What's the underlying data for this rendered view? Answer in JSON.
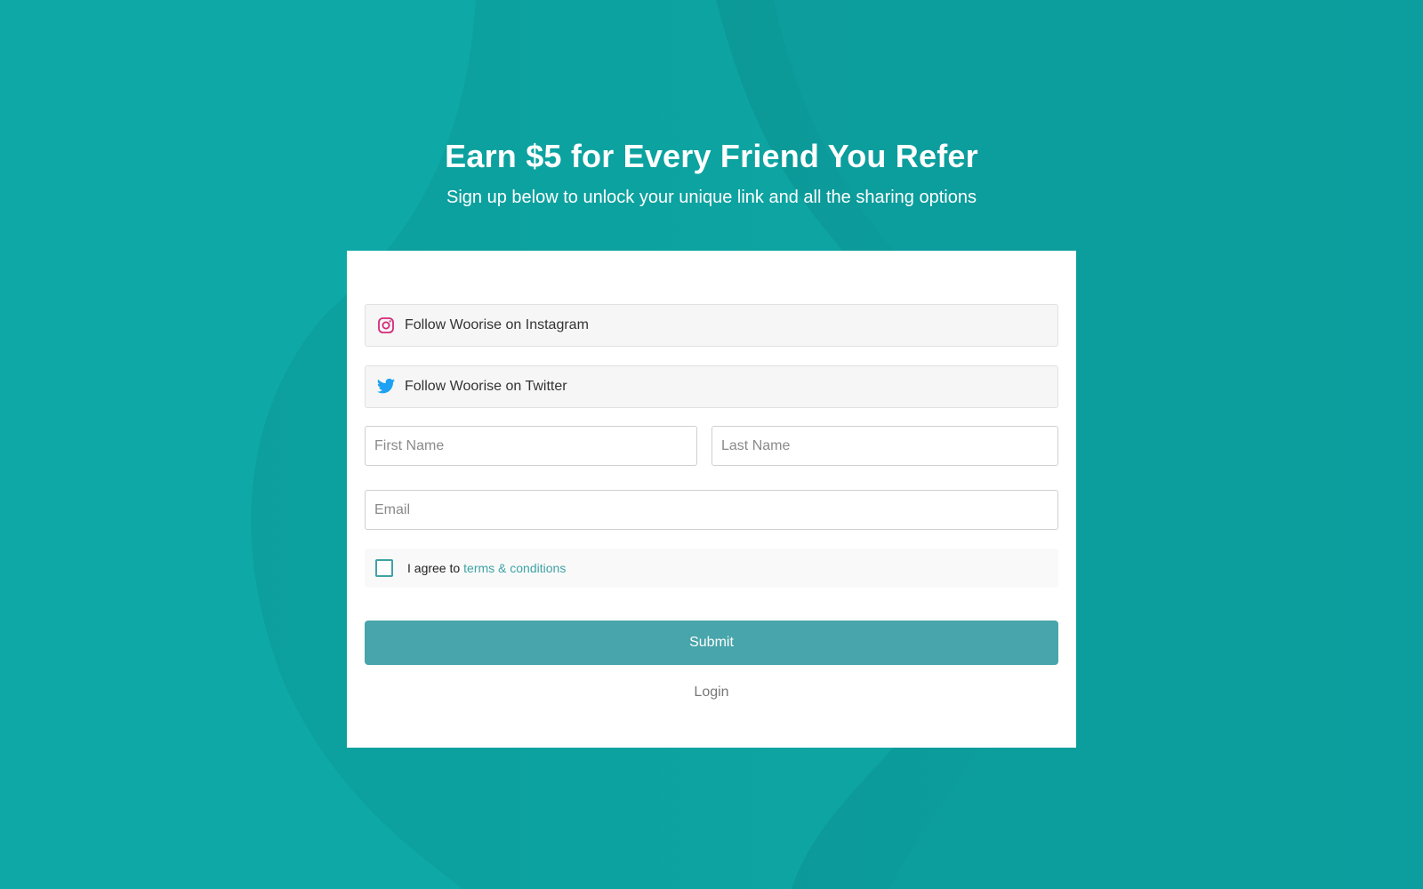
{
  "hero": {
    "title": "Earn $5 for Every Friend You Refer",
    "subtitle": "Sign up below to unlock your unique link and all the sharing options"
  },
  "actions": [
    {
      "label": "Follow Woorise on Instagram",
      "icon": "instagram-icon",
      "color": "#d6287a"
    },
    {
      "label": "Follow Woorise on Twitter",
      "icon": "twitter-icon",
      "color": "#1da1f2"
    }
  ],
  "form": {
    "first_name_placeholder": "First Name",
    "last_name_placeholder": "Last Name",
    "email_placeholder": "Email",
    "agree_text": "I agree to",
    "terms_link": "terms & conditions",
    "submit_label": "Submit",
    "login_label": "Login"
  },
  "colors": {
    "background": "#0ea9a6",
    "accent": "#47a5ab",
    "link": "#3fa3a5"
  }
}
